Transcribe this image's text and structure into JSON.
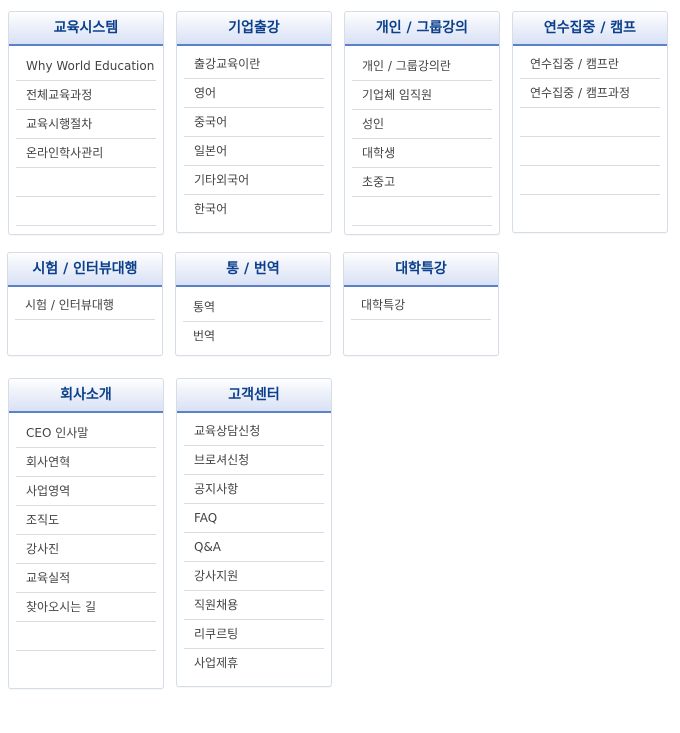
{
  "menus": [
    {
      "title": "교육시스템",
      "items": [
        "Why World Education",
        "전체교육과정",
        "교육시행절차",
        "온라인학사관리"
      ]
    },
    {
      "title": "기업출강",
      "items": [
        "출강교육이란",
        "영어",
        "중국어",
        "일본어",
        "기타외국어",
        "한국어"
      ]
    },
    {
      "title": "개인 / 그룹강의",
      "items": [
        "개인 / 그룹강의란",
        "기업체 임직원",
        "성인",
        "대학생",
        "초중고"
      ]
    },
    {
      "title": "연수집중 / 캠프",
      "items": [
        "연수집중 / 캠프란",
        "연수집중 / 캠프과정"
      ]
    },
    {
      "title": "시험 / 인터뷰대행",
      "items": [
        "시험 / 인터뷰대행"
      ]
    },
    {
      "title": "통 / 번역",
      "items": [
        "통역",
        "번역"
      ]
    },
    {
      "title": "대학특강",
      "items": [
        "대학특강"
      ]
    },
    {
      "title": "회사소개",
      "items": [
        "CEO 인사말",
        "회사연혁",
        "사업영역",
        "조직도",
        "강사진",
        "교육실적",
        "찾아오시는 길"
      ]
    },
    {
      "title": "고객센터",
      "items": [
        "교육상담신청",
        "브로셔신청",
        "공지사항",
        "FAQ",
        "Q&A",
        "강사지원",
        "직원채용",
        "리쿠르팅",
        "사업제휴"
      ]
    }
  ]
}
